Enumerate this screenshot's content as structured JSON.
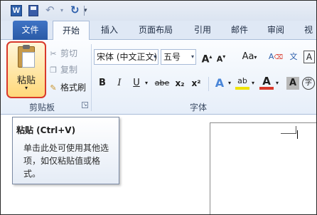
{
  "quick_access": {
    "app_icon_letter": "W"
  },
  "tabs": [
    "文件",
    "开始",
    "插入",
    "页面布局",
    "引用",
    "邮件",
    "审阅",
    "视"
  ],
  "clipboard": {
    "paste_label": "粘贴",
    "cut_label": "剪切",
    "copy_label": "复制",
    "format_painter_label": "格式刷",
    "group_label": "剪贴板"
  },
  "font_group": {
    "font_name": "宋体 (中文正文)",
    "font_size": "五号",
    "grow": "A",
    "shrink": "A",
    "change_case": "Aa",
    "clear_format": "A",
    "bold": "B",
    "italic": "I",
    "underline": "U",
    "strikethrough": "abe",
    "subscript": "x₂",
    "superscript": "x²",
    "text_effects": "A",
    "highlight": "ab",
    "font_color": "A",
    "char_shading": "A",
    "enclose": "字",
    "group_label": "字体"
  },
  "tooltip": {
    "title": "粘贴 (Ctrl+V)",
    "body": "单击此处可使用其他选项，如仅粘贴值或格式。"
  },
  "colors": {
    "file_tab": "#2a5aa6",
    "paste_highlight": "#d9392b",
    "font_color_bar": "#d9392b",
    "highlight_bar": "#f0e300"
  }
}
